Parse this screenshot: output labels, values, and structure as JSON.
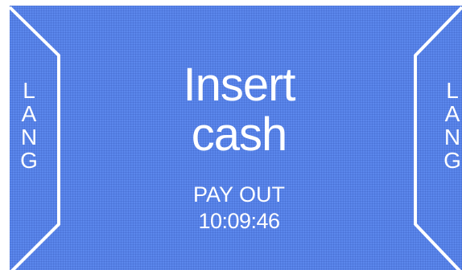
{
  "lang_left": {
    "letters": [
      "L",
      "A",
      "N",
      "G"
    ]
  },
  "lang_right": {
    "letters": [
      "L",
      "A",
      "N",
      "G"
    ]
  },
  "message": {
    "line1": "Insert",
    "line2": "cash"
  },
  "payout": {
    "label": "PAY OUT"
  },
  "clock": {
    "time": "10:09:46"
  },
  "colors": {
    "background": "#5b87ec",
    "text": "#ffffff",
    "lines": "#ffffff"
  }
}
